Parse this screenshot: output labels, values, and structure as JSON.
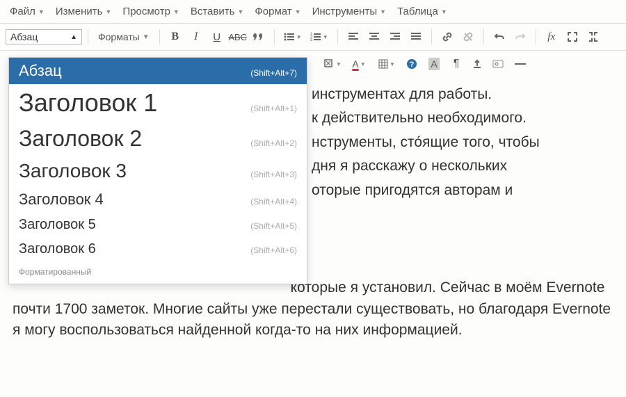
{
  "menubar": {
    "items": [
      "Файл",
      "Изменить",
      "Просмотр",
      "Вставить",
      "Формат",
      "Инструменты",
      "Таблица"
    ]
  },
  "toolbar": {
    "format_select": "Абзац",
    "formats_label": "Форматы"
  },
  "dropdown": {
    "selected": {
      "label": "Абзац",
      "shortcut": "(Shift+Alt+7)"
    },
    "items": [
      {
        "label": "Заголовок 1",
        "shortcut": "(Shift+Alt+1)",
        "size": 36
      },
      {
        "label": "Заголовок 2",
        "shortcut": "(Shift+Alt+2)",
        "size": 32
      },
      {
        "label": "Заголовок 3",
        "shortcut": "(Shift+Alt+3)",
        "size": 28
      },
      {
        "label": "Заголовок 4",
        "shortcut": "(Shift+Alt+4)",
        "size": 22
      },
      {
        "label": "Заголовок 5",
        "shortcut": "(Shift+Alt+5)",
        "size": 20
      },
      {
        "label": "Заголовок 6",
        "shortcut": "(Shift+Alt+6)",
        "size": 20
      }
    ],
    "footer": "Форматированный"
  },
  "content": {
    "p1_a": "инструментах для работы.",
    "p1_b": "к действительно необходимого.",
    "p1_c": "нструменты, сто́ящие того, чтобы",
    "p1_d": "дня я расскажу о нескольких",
    "p1_e": "оторые пригодятся авторам и",
    "p2": "которые я установил. Сейчас в моём Evernote почти 1700 заметок. Многие сайты уже перестали существовать, но благодаря Evernote я могу воспользоваться найденной когда-то на них информацией."
  }
}
